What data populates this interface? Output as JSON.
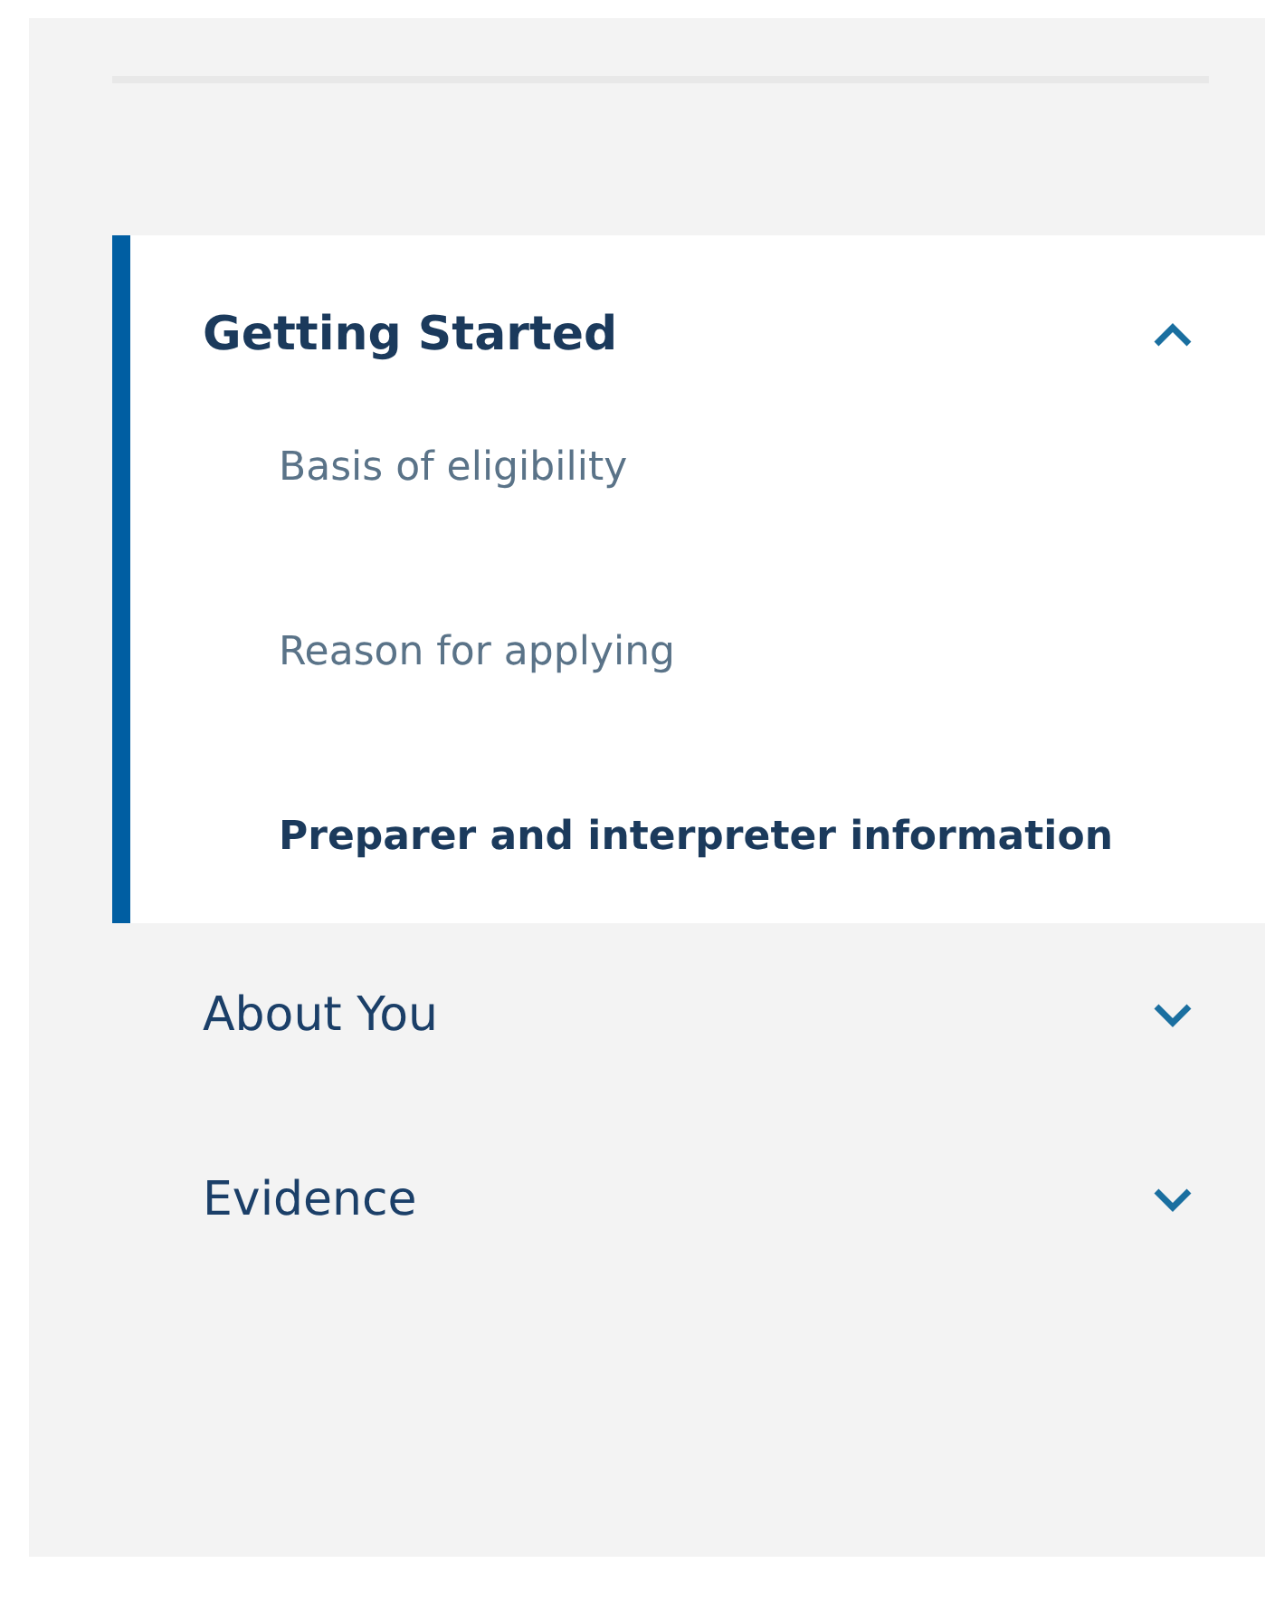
{
  "sections": [
    {
      "label": "Getting Started",
      "expanded": true,
      "items": [
        {
          "label": "Basis of eligibility",
          "selected": false
        },
        {
          "label": "Reason for applying",
          "selected": false
        },
        {
          "label": "Preparer and interpreter information",
          "selected": true
        }
      ]
    },
    {
      "label": "About You",
      "expanded": false
    },
    {
      "label": "Evidence",
      "expanded": false
    }
  ]
}
